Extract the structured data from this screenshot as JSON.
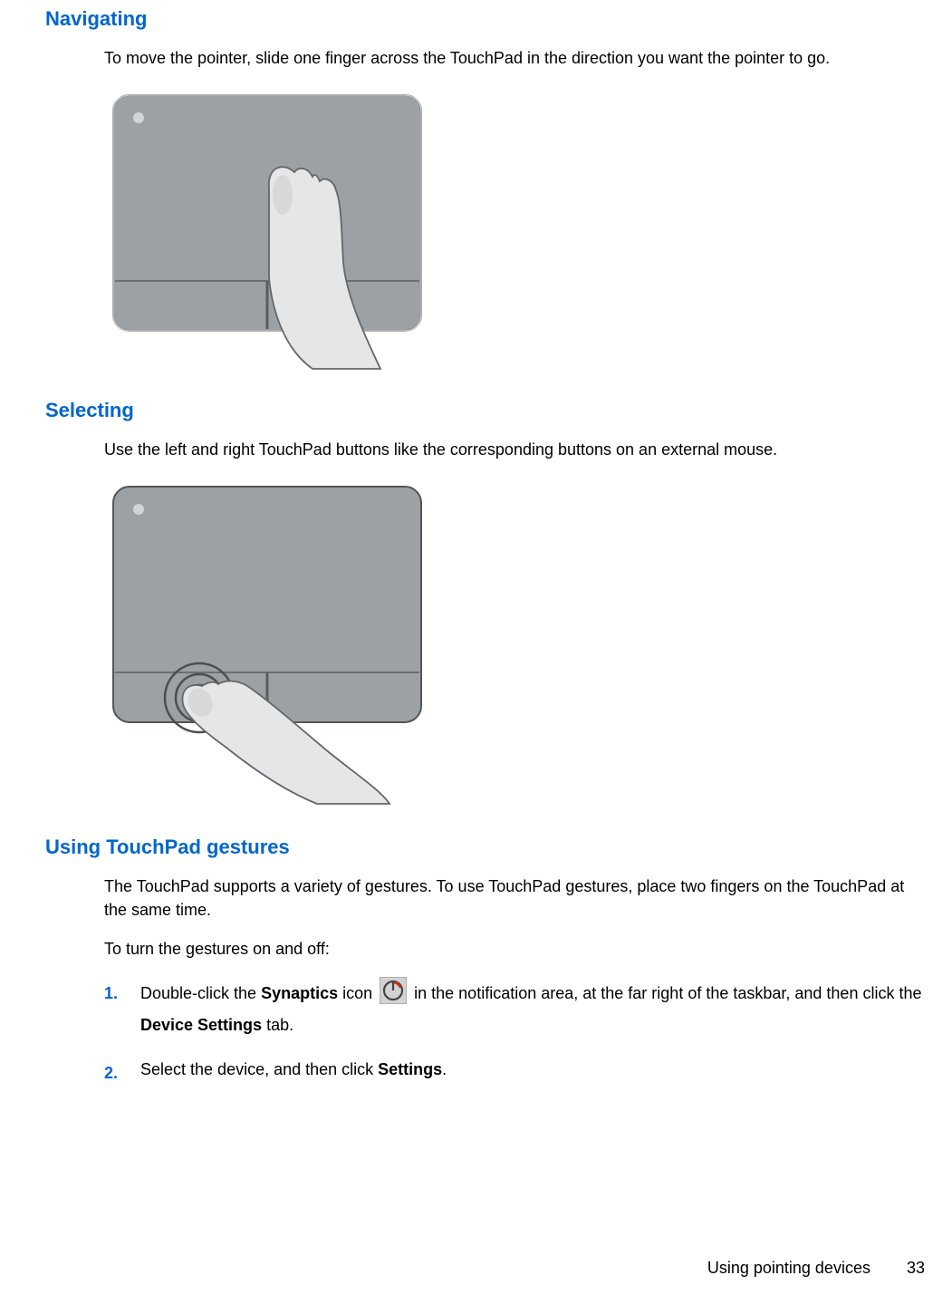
{
  "sections": {
    "navigating": {
      "heading": "Navigating",
      "body": "To move the pointer, slide one finger across the TouchPad in the direction you want the pointer to go."
    },
    "selecting": {
      "heading": "Selecting",
      "body": "Use the left and right TouchPad buttons like the corresponding buttons on an external mouse."
    },
    "gestures": {
      "heading": "Using TouchPad gestures",
      "body": "The TouchPad supports a variety of gestures. To use TouchPad gestures, place two fingers on the TouchPad at the same time.",
      "intro": "To turn the gestures on and off:",
      "steps": {
        "s1_num": "1.",
        "s1_a": "Double-click the ",
        "s1_bold1": "Synaptics",
        "s1_b": " icon ",
        "s1_c": " in the notification area, at the far right of the taskbar, and then click the ",
        "s1_bold2": "Device Settings",
        "s1_d": " tab.",
        "s2_num": "2.",
        "s2_a": "Select the device, and then click ",
        "s2_bold1": "Settings",
        "s2_b": "."
      }
    }
  },
  "footer": {
    "text": "Using pointing devices",
    "page": "33"
  }
}
